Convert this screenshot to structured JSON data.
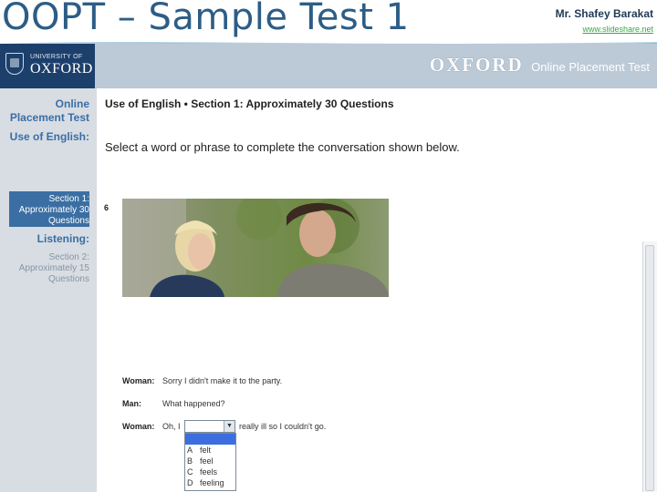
{
  "slide": {
    "title": "OOPT – Sample Test 1",
    "author": "Mr. Shafey Barakat",
    "author_link": "www.slideshare.net"
  },
  "header": {
    "university_of": "UNIVERSITY OF",
    "university_name": "OXFORD",
    "brand_name": "OXFORD",
    "brand_subtitle": "Online Placement Test"
  },
  "sidebar": {
    "title_line1": "Online",
    "title_line2": "Placement Test",
    "use_of_english": "Use of English:",
    "section1": [
      "Section 1:",
      "Approximately 30",
      "Questions"
    ],
    "listening": "Listening:",
    "section2": [
      "Section 2:",
      "Approximately 15",
      "Questions"
    ]
  },
  "main": {
    "section_heading": "Use of English • Section 1: Approximately 30 Questions",
    "instruction": "Select a word or phrase to complete the conversation shown below.",
    "question_number": "6",
    "conversation": [
      {
        "speaker": "Woman:",
        "text": "Sorry I didn't make it to the party."
      },
      {
        "speaker": "Man:",
        "text": "What happened?"
      },
      {
        "speaker": "Woman:",
        "text": "Oh, I"
      }
    ],
    "after_blank": "really ill so I couldn't go.",
    "dropdown_options": [
      {
        "letter": "A",
        "text": "felt"
      },
      {
        "letter": "B",
        "text": "feel"
      },
      {
        "letter": "C",
        "text": "feels"
      },
      {
        "letter": "D",
        "text": "feeling"
      }
    ]
  },
  "colors": {
    "title": "#2c5d86",
    "navy": "#1c3f6b",
    "sidebar_active": "#3b6fa3",
    "highlight": "#3d6ee0"
  }
}
